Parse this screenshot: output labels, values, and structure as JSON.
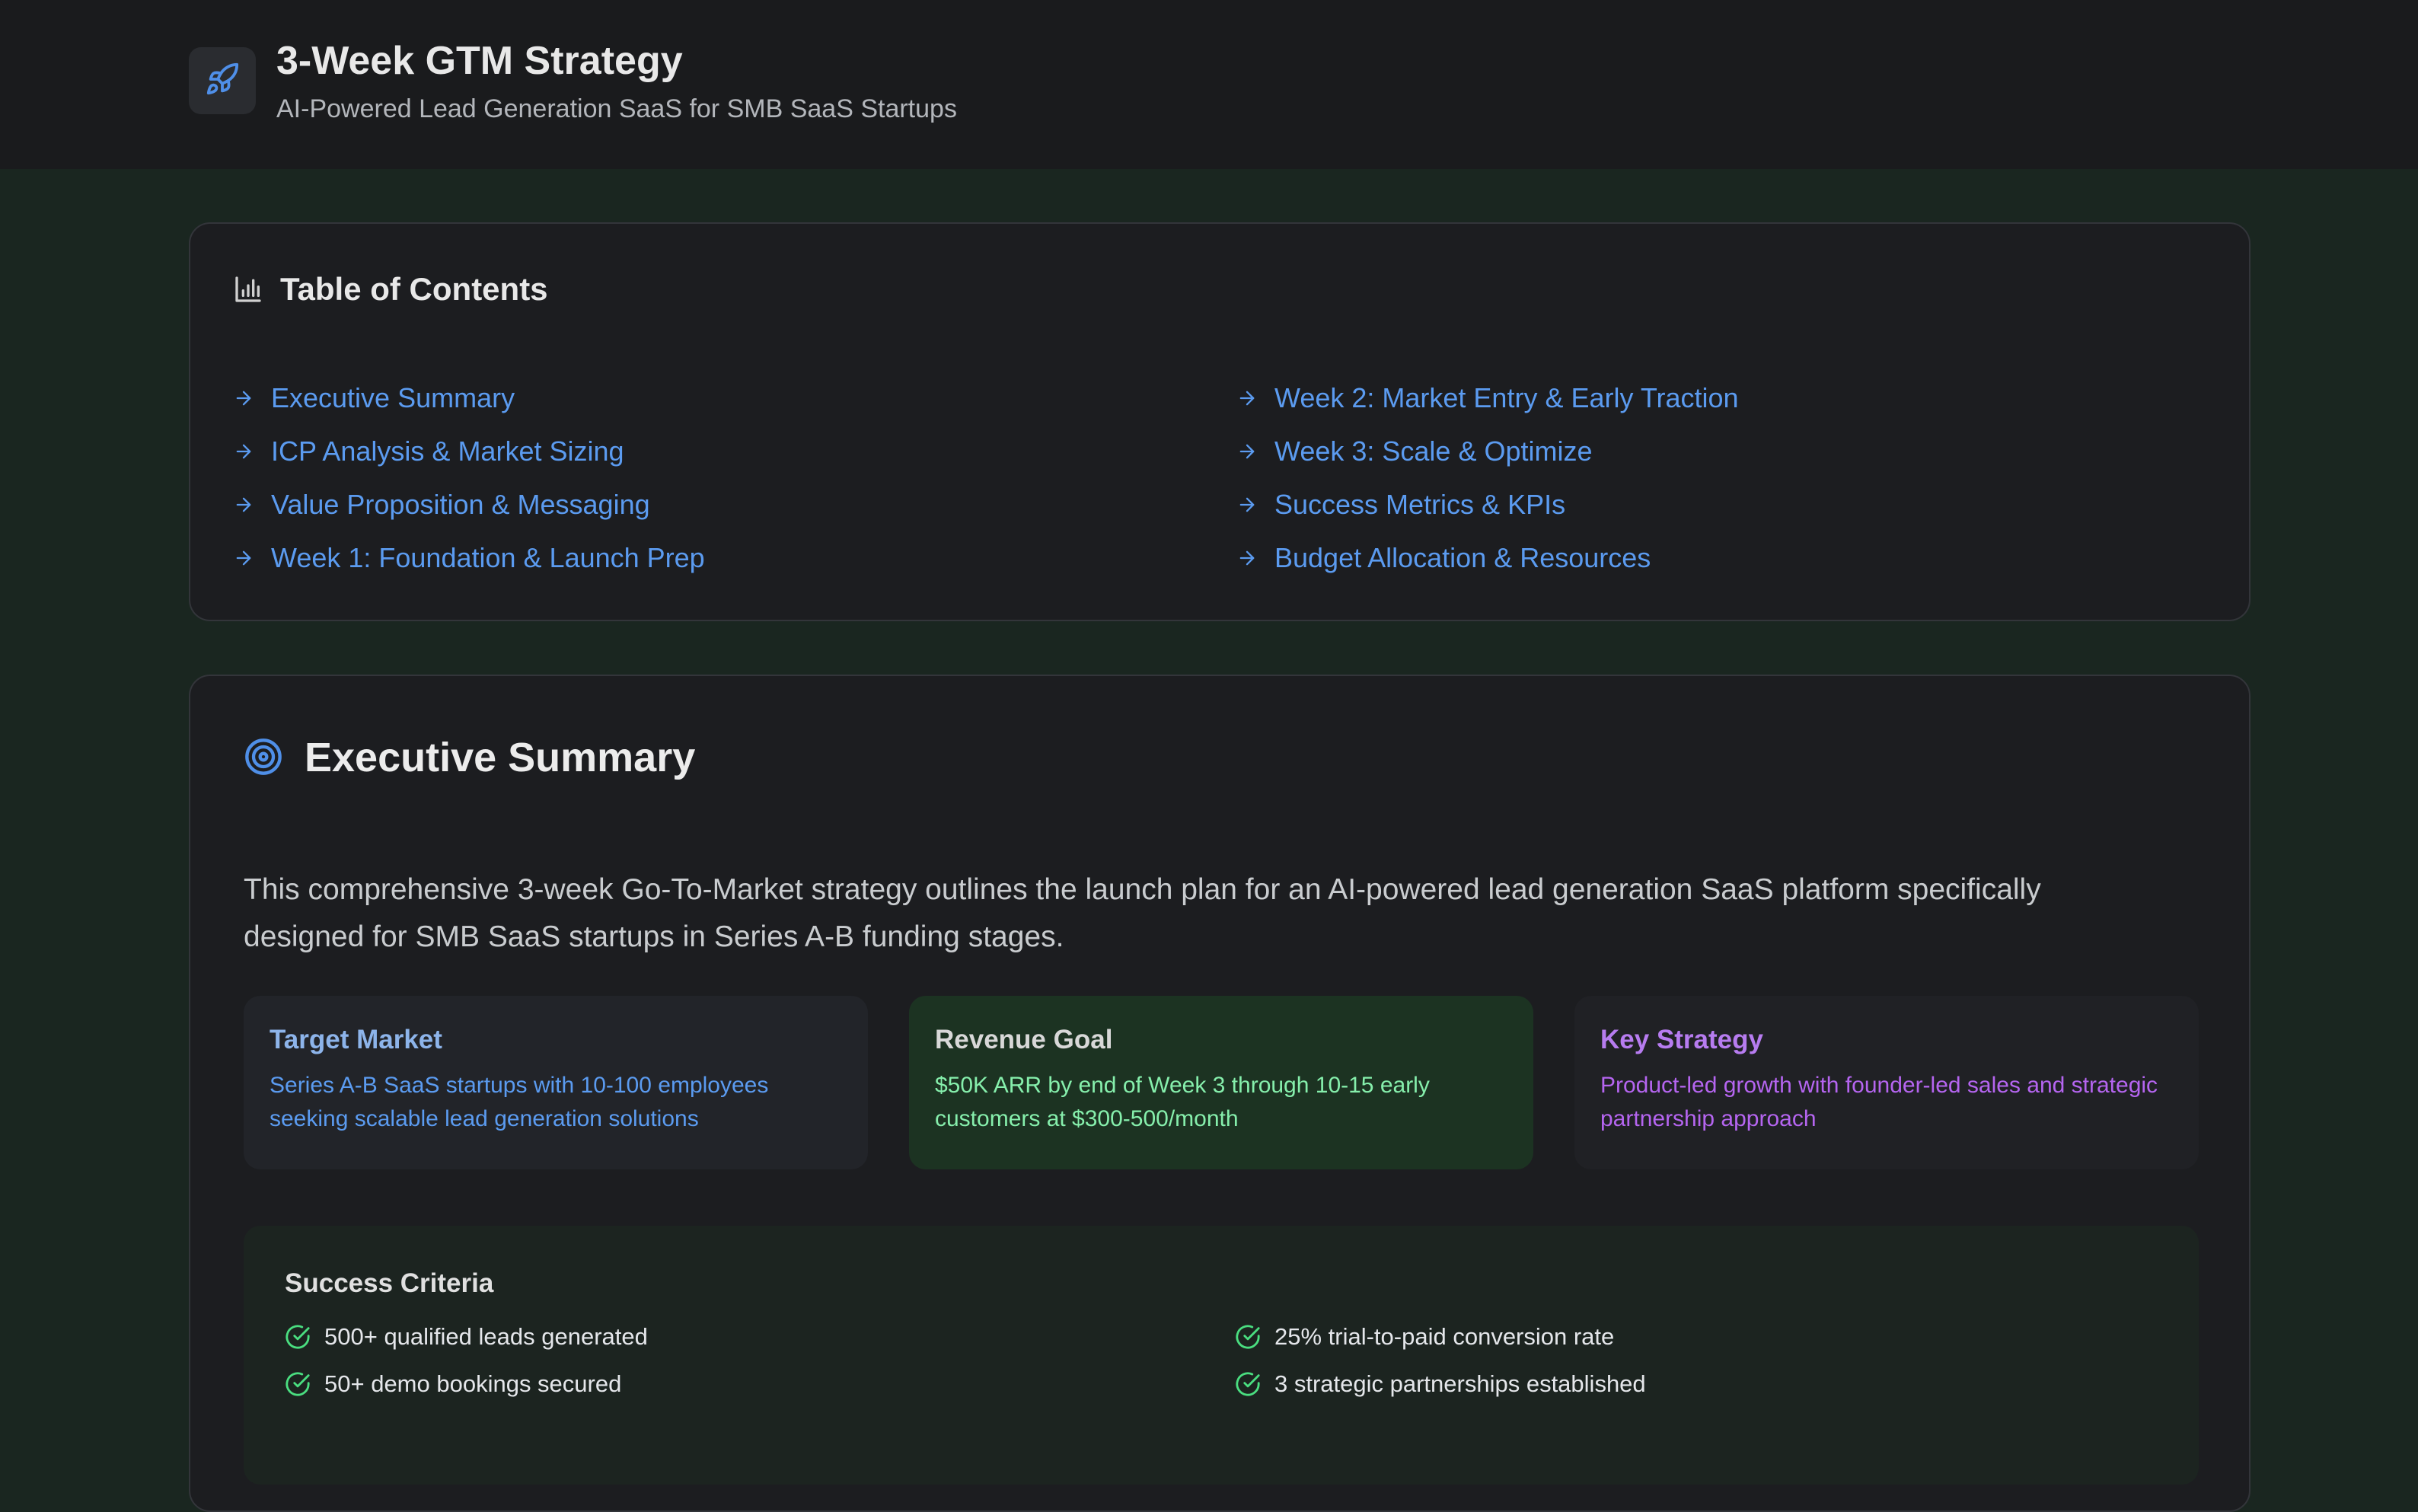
{
  "header": {
    "title": "3-Week GTM Strategy",
    "subtitle": "AI-Powered Lead Generation SaaS for SMB SaaS Startups",
    "logo_icon": "rocket-icon"
  },
  "toc": {
    "title": "Table of Contents",
    "icon": "bar-chart-icon",
    "items_left": [
      "Executive Summary",
      "ICP Analysis & Market Sizing",
      "Value Proposition & Messaging",
      "Week 1: Foundation & Launch Prep"
    ],
    "items_right": [
      "Week 2: Market Entry & Early Traction",
      "Week 3: Scale & Optimize",
      "Success Metrics & KPIs",
      "Budget Allocation & Resources"
    ]
  },
  "executive": {
    "title": "Executive Summary",
    "icon": "target-icon",
    "intro": "This comprehensive 3-week Go-To-Market strategy outlines the launch plan for an AI-powered lead generation SaaS platform specifically designed for SMB SaaS startups in Series A-B funding stages.",
    "cards": {
      "target": {
        "heading": "Target Market",
        "body": "Series A-B SaaS startups with 10-100 employees seeking scalable lead generation solutions"
      },
      "revenue": {
        "heading": "Revenue Goal",
        "body": "$50K ARR by end of Week 3 through 10-15 early customers at $300-500/month"
      },
      "strategy": {
        "heading": "Key Strategy",
        "body": "Product-led growth with founder-led sales and strategic partnership approach"
      }
    },
    "success": {
      "title": "Success Criteria",
      "left": [
        "500+ qualified leads generated",
        "50+ demo bookings secured"
      ],
      "right": [
        "25% trial-to-paid conversion rate",
        "3 strategic partnerships established"
      ]
    }
  },
  "colors": {
    "link": "#5b9bf0",
    "success_check": "#4ade80",
    "strategy_purple": "#b565f0"
  }
}
